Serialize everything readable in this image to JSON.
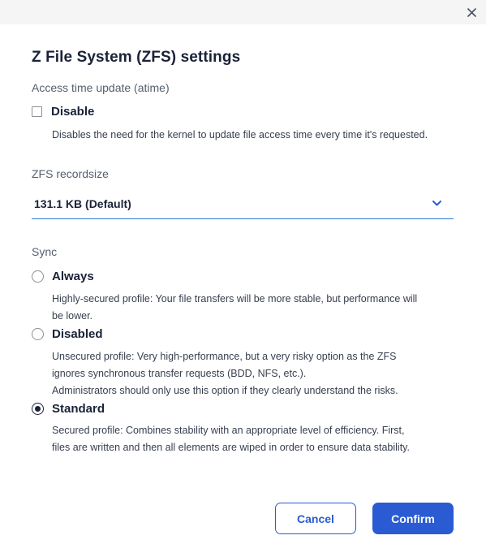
{
  "dialog": {
    "title": "Z File System (ZFS) settings",
    "close_icon": "close-icon"
  },
  "atime": {
    "section_label": "Access time update (atime)",
    "checkbox_label": "Disable",
    "checked": false,
    "description": "Disables the need for the kernel to update file access time every time it's requested."
  },
  "recordsize": {
    "section_label": "ZFS recordsize",
    "selected_value": "131.1 KB (Default)",
    "chevron_icon": "chevron-down-icon"
  },
  "sync": {
    "section_label": "Sync",
    "selected": "Standard",
    "options": [
      {
        "label": "Always",
        "description_lines": [
          "Highly-secured profile: Your file transfers will be more stable, but performance will",
          "be lower."
        ]
      },
      {
        "label": "Disabled",
        "description_lines": [
          "Unsecured profile: Very high-performance, but a very risky option as the ZFS",
          "ignores synchronous transfer requests (BDD, NFS, etc.).",
          "Administrators should only use this option if they clearly understand the risks."
        ]
      },
      {
        "label": "Standard",
        "description_lines": [
          "Secured profile: Combines stability with an appropriate level of efficiency. First,",
          "files are written and then all elements are wiped in order to ensure data stability."
        ]
      }
    ]
  },
  "footer": {
    "cancel_label": "Cancel",
    "confirm_label": "Confirm"
  },
  "colors": {
    "primary": "#2a5bd2",
    "select_underline": "#2c7dd0",
    "title_text": "#1a2238",
    "topbar_bg": "#f5f5f5"
  }
}
